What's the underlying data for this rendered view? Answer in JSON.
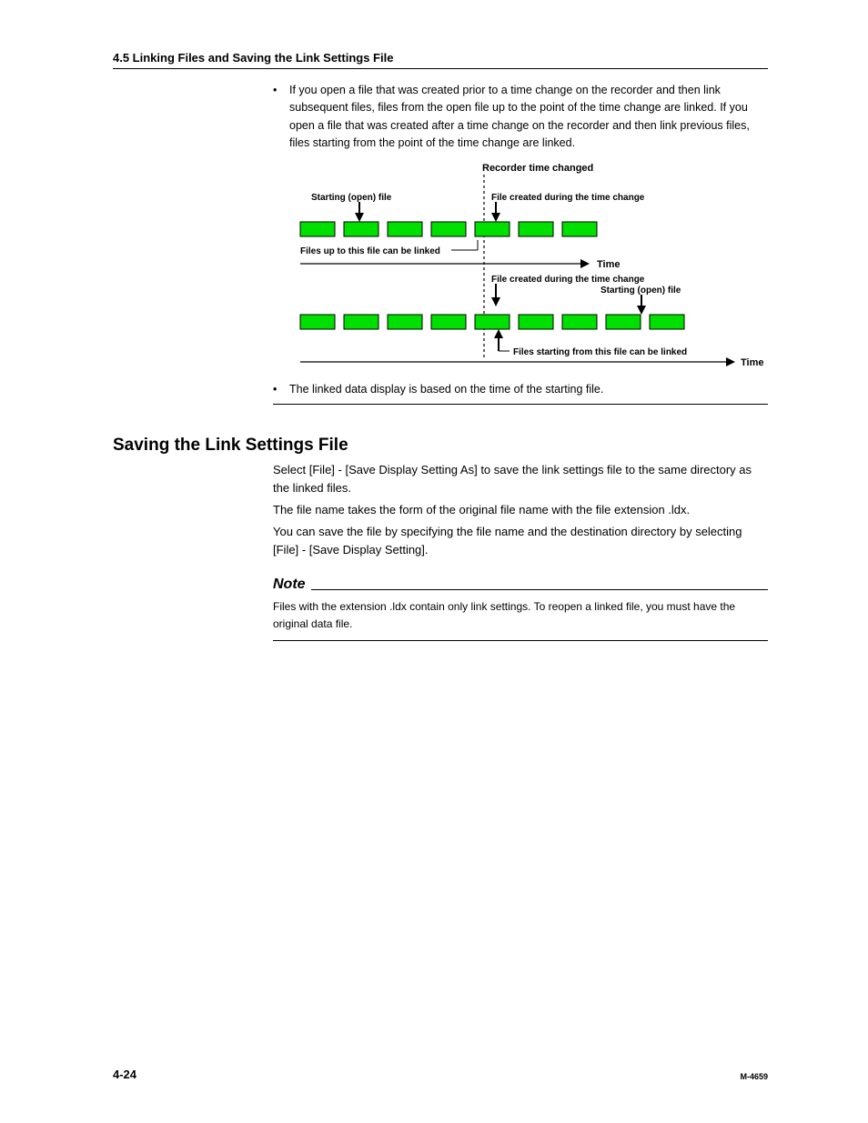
{
  "header": {
    "section_title": "4.5  Linking Files and Saving the Link Settings File"
  },
  "bullets": {
    "b1": "If you open a file that was created prior to a time change on the recorder and then link subsequent files, files from the open file up to the point of the time change are linked. If you open a file that was created after a time change on the recorder and then link previous files, files starting from the point of the time change are linked.",
    "b2": "The linked data display is based on the time of the starting file."
  },
  "diagram": {
    "top_title": "Recorder time changed",
    "labels": {
      "starting_open_file": "Starting (open) file",
      "file_created_during_change": "File created during the time change",
      "files_up_to": "Files up to this file can be linked",
      "files_starting_from": "Files starting from this file can be linked",
      "time": "Time"
    }
  },
  "h2": "Saving the Link Settings File",
  "p1": "Select [File] - [Save Display Setting As] to save the link settings file to the same directory as the linked files.",
  "p2": "The file name takes the form of the original file name with the file extension .ldx.",
  "p3": "You can save the file by specifying the file name and the destination directory by selecting [File] - [Save Display Setting].",
  "note": {
    "title": "Note",
    "body": "Files with the extension .ldx contain only link settings.  To reopen a linked file, you must have the original data file."
  },
  "footer": {
    "page": "4-24",
    "manual": "M-4659"
  }
}
